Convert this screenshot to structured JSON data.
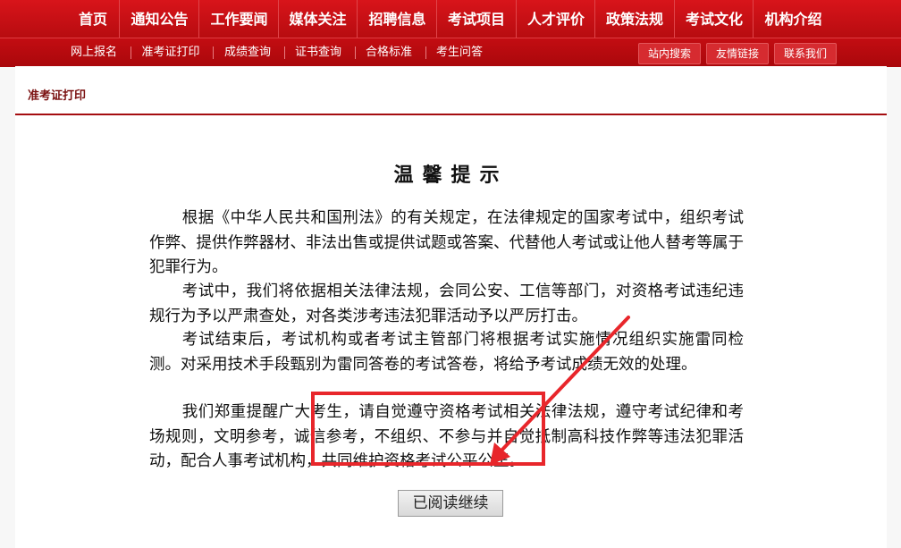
{
  "topnav": [
    "首页",
    "通知公告",
    "工作要闻",
    "媒体关注",
    "招聘信息",
    "考试项目",
    "人才评价",
    "政策法规",
    "考试文化",
    "机构介绍"
  ],
  "subnav": [
    "网上报名",
    "准考证打印",
    "成绩查询",
    "证书查询",
    "合格标准",
    "考生问答"
  ],
  "utility": [
    "站内搜索",
    "友情链接",
    "联系我们"
  ],
  "breadcrumb": "准考证打印",
  "notice": {
    "title": "温馨提示",
    "paragraphs": [
      "根据《中华人民共和国刑法》的有关规定，在法律规定的国家考试中，组织考试作弊、提供作弊器材、非法出售或提供试题或答案、代替他人考试或让他人替考等属于犯罪行为。",
      "考试中，我们将依据相关法律法规，会同公安、工信等部门，对资格考试违纪违规行为予以严肃查处，对各类涉考违法犯罪活动予以严厉打击。",
      "考试结束后，考试机构或者考试主管部门将根据考试实施情况组织实施雷同检测。对采用技术手段甄别为雷同答卷的考试答卷，将给予考试成绩无效的处理。",
      "我们郑重提醒广大考生，请自觉遵守资格考试相关法律法规，遵守考试纪律和考场规则，文明参考，诚信参考，不组织、不参与并自觉抵制高科技作弊等违法犯罪活动，配合人事考试机构，共同维护资格考试公平公正。"
    ],
    "continue_label": "已阅读继续"
  },
  "colors": {
    "brand_red": "#c30d12",
    "annotation_red": "#e8262b"
  }
}
